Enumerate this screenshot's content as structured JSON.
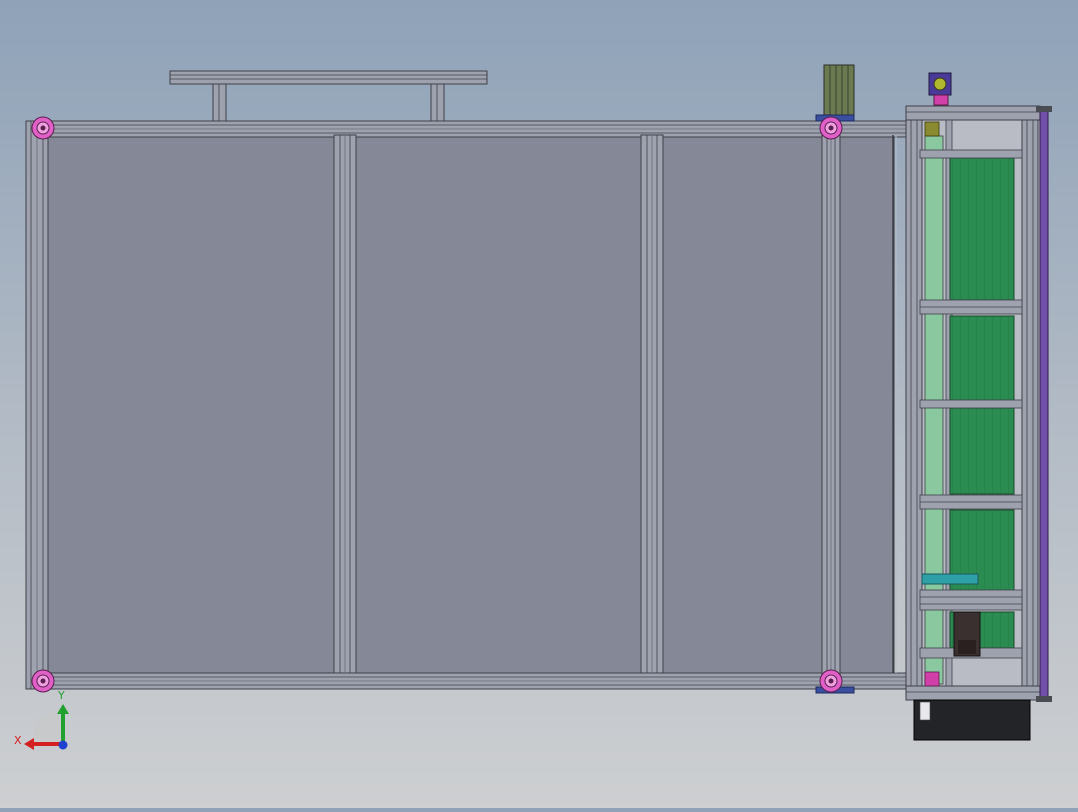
{
  "scene": {
    "view": "top",
    "colors": {
      "background_top": "#8fa2b8",
      "background_bottom": "#cdcfd1",
      "panel": "#858896",
      "frame": "#9ea2ae",
      "frame_edge": "#3e4048",
      "connector": "#e060c8",
      "pcb": "#2a8c50",
      "motor": "#6c7a52",
      "motor_mount": "#3a4fa0",
      "rail_purple": "#7050a8",
      "cable_teal": "#30a0a8",
      "drive_box": "#222428"
    }
  },
  "axes": {
    "x_label": "X",
    "y_label": "Y",
    "x_color": "#d42020",
    "y_color": "#22a030",
    "z_color": "#2040d0"
  }
}
